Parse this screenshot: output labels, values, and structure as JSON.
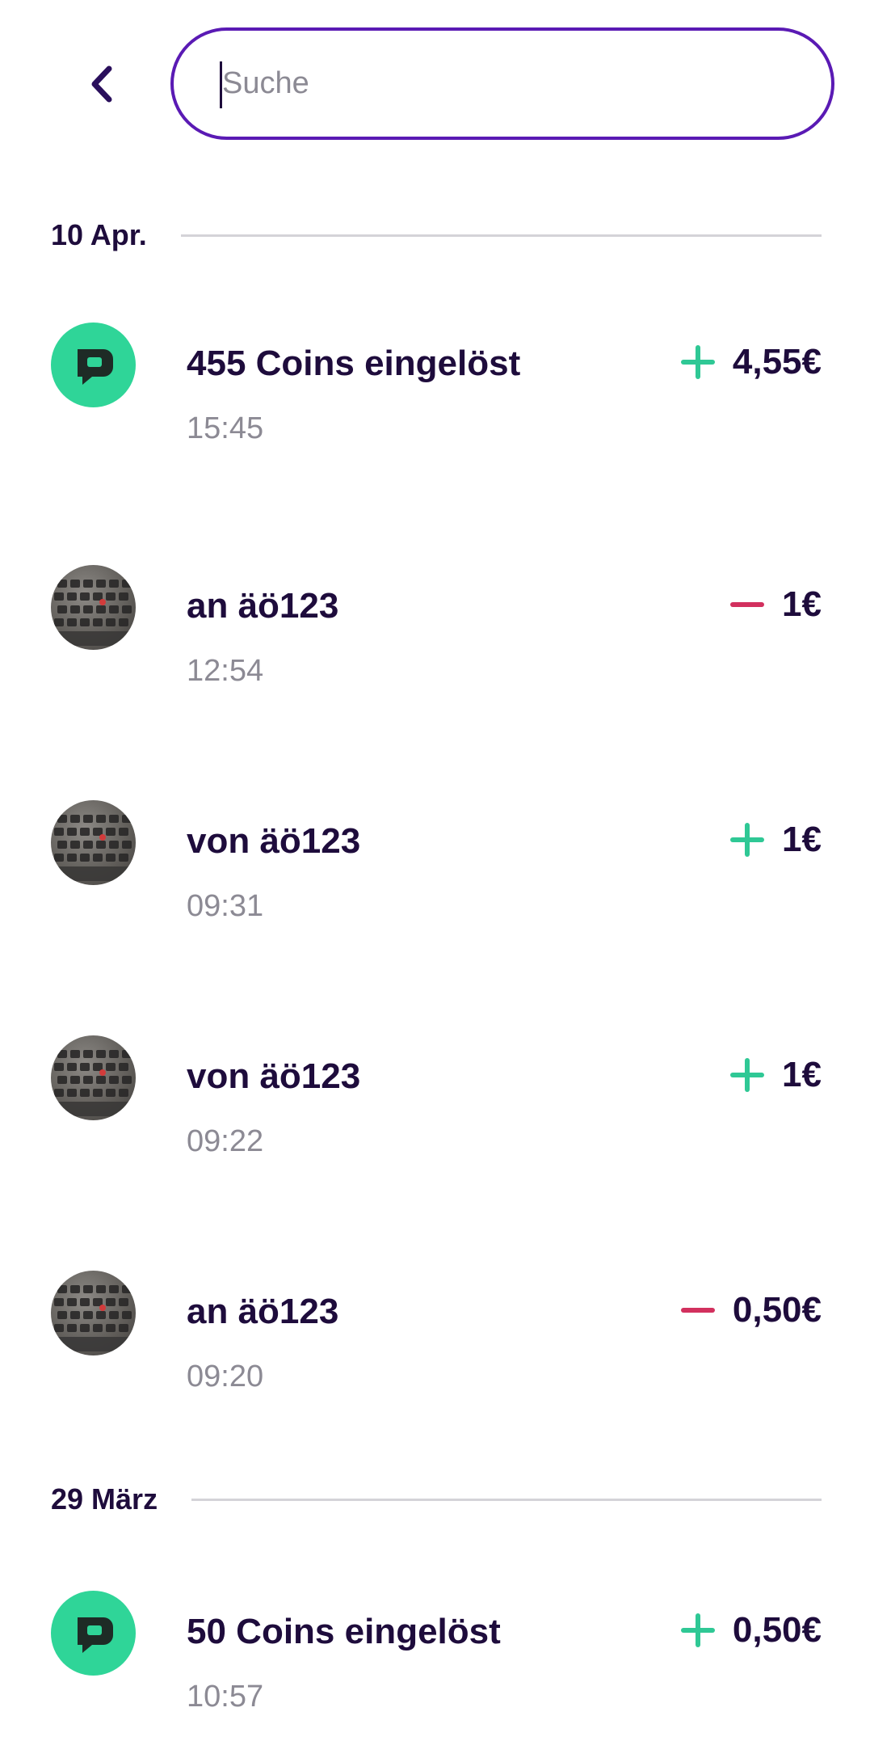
{
  "search": {
    "placeholder": "Suche"
  },
  "sections": [
    {
      "date": "10 Apr.",
      "transactions": [
        {
          "title": "455 Coins eingelöst",
          "time": "15:45",
          "amount": "4,55€",
          "direction": "plus",
          "avatar": "brand-logo-icon"
        },
        {
          "title": "an äö123",
          "time": "12:54",
          "amount": "1€",
          "direction": "minus",
          "avatar": "user-photo"
        },
        {
          "title": "von äö123",
          "time": "09:31",
          "amount": "1€",
          "direction": "plus",
          "avatar": "user-photo"
        },
        {
          "title": "von äö123",
          "time": "09:22",
          "amount": "1€",
          "direction": "plus",
          "avatar": "user-photo"
        },
        {
          "title": "an äö123",
          "time": "09:20",
          "amount": "0,50€",
          "direction": "minus",
          "avatar": "user-photo"
        }
      ]
    },
    {
      "date": "29 März",
      "transactions": [
        {
          "title": "50 Coins eingelöst",
          "time": "10:57",
          "amount": "0,50€",
          "direction": "plus",
          "avatar": "brand-logo-icon"
        }
      ]
    }
  ],
  "colors": {
    "accent": "#5a1ab4",
    "positive": "#2fc895",
    "negative": "#d2305e",
    "brand": "#2fd598",
    "text": "#1e0c3c",
    "muted": "#8c8a94"
  }
}
